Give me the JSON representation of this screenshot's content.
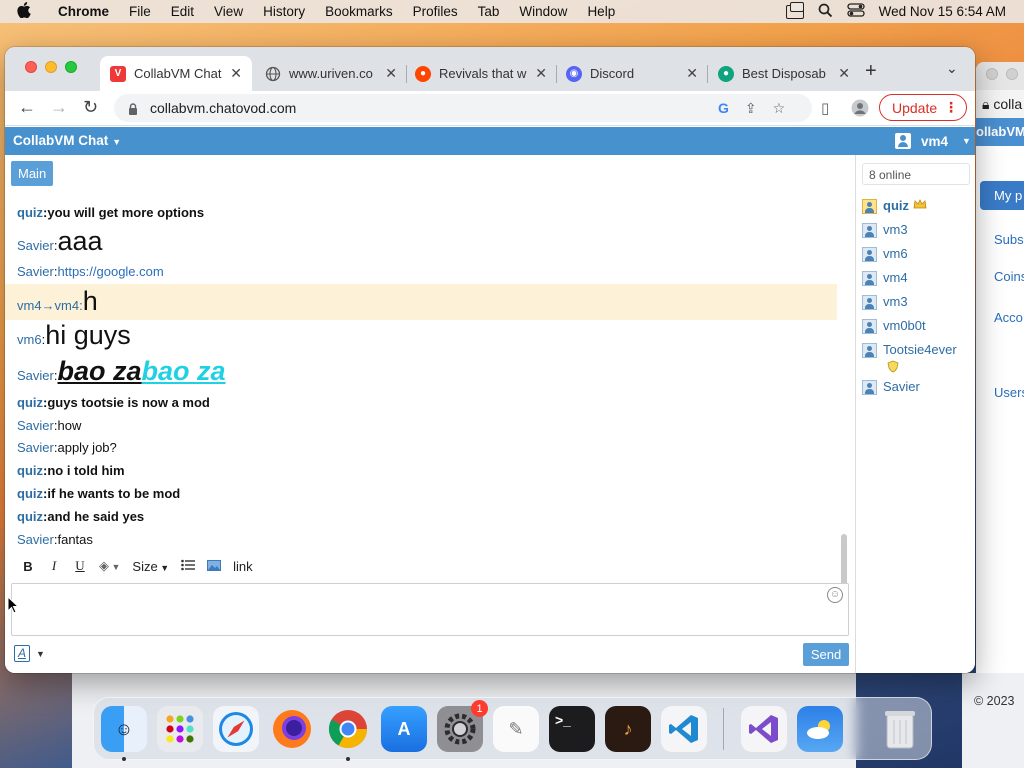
{
  "menubar": {
    "app": "Chrome",
    "items": [
      "File",
      "Edit",
      "View",
      "History",
      "Bookmarks",
      "Profiles",
      "Tab",
      "Window",
      "Help"
    ],
    "clock": "Wed Nov 15  6:54 AM"
  },
  "browser": {
    "tabs": [
      {
        "title": "CollabVM Chat",
        "favicon": "vivaldi-icon",
        "active": true
      },
      {
        "title": "www.uriven.co",
        "favicon": "globe-icon"
      },
      {
        "title": "Revivals that w",
        "favicon": "reddit-icon"
      },
      {
        "title": "Discord",
        "favicon": "discord-icon"
      },
      {
        "title": "Best Disposab",
        "favicon": "green-icon"
      }
    ],
    "url": "collabvm.chatovod.com",
    "update_label": "Update"
  },
  "chat": {
    "brand": "CollabVM Chat",
    "user": "vm4",
    "room_tab": "Main",
    "messages": [
      {
        "nick": "quiz",
        "sep": ": ",
        "text": "you will get more options"
      },
      {
        "nick": "Savier",
        "sep": ": ",
        "text": "aaa"
      },
      {
        "nick": "Savier",
        "sep": ": ",
        "text": "https://google.com"
      },
      {
        "nick": "vm4→vm4",
        "sep": ": ",
        "text": "h"
      },
      {
        "nick": "vm6",
        "sep": ": ",
        "text": "hi guys"
      },
      {
        "nick": "Savier",
        "sep": ": ",
        "text_a": "bao za",
        "text_b": "bao za"
      },
      {
        "nick": "quiz",
        "sep": ": ",
        "text": "guys tootsie is now a mod"
      },
      {
        "nick": "Savier",
        "sep": ": ",
        "text": "how"
      },
      {
        "nick": "Savier",
        "sep": ": ",
        "text": "apply job?"
      },
      {
        "nick": "quiz",
        "sep": ": ",
        "text": "no i told him"
      },
      {
        "nick": "quiz",
        "sep": ": ",
        "text": "if he wants to be mod"
      },
      {
        "nick": "quiz",
        "sep": ": ",
        "text": "and he said yes"
      },
      {
        "nick": "Savier",
        "sep": ": ",
        "text": "fantas"
      }
    ],
    "online_count": "8 online",
    "users": [
      "quiz",
      "vm3",
      "vm6",
      "vm4",
      "vm3",
      "vm0b0t",
      "Tootsie4ever",
      "Savier"
    ],
    "editor": {
      "bold": "B",
      "italic": "I",
      "underline": "U",
      "size": "Size",
      "link": "link",
      "font_icon": "A",
      "send": "Send"
    }
  },
  "background_window": {
    "address": "colla",
    "brand": "ollabVM",
    "pill": "My p",
    "links": [
      "Subs",
      "Coins",
      "Acco",
      "Users"
    ],
    "copyright": "© 2023"
  },
  "dock": {
    "apps": [
      "Finder",
      "Launchpad",
      "Safari",
      "Firefox",
      "Chrome",
      "App Store",
      "System Settings",
      "TextEdit",
      "Terminal",
      "GarageBand",
      "Visual Studio Code",
      "Visual Studio",
      "Weather",
      "Trash"
    ],
    "settings_badge": "1"
  },
  "colors": {
    "chat_blue": "#4891cf",
    "nick_blue": "#2e6da4",
    "pm_highlight": "#fdf1d8",
    "cyan_text": "#1fd1e3",
    "update_red": "#d93025"
  }
}
